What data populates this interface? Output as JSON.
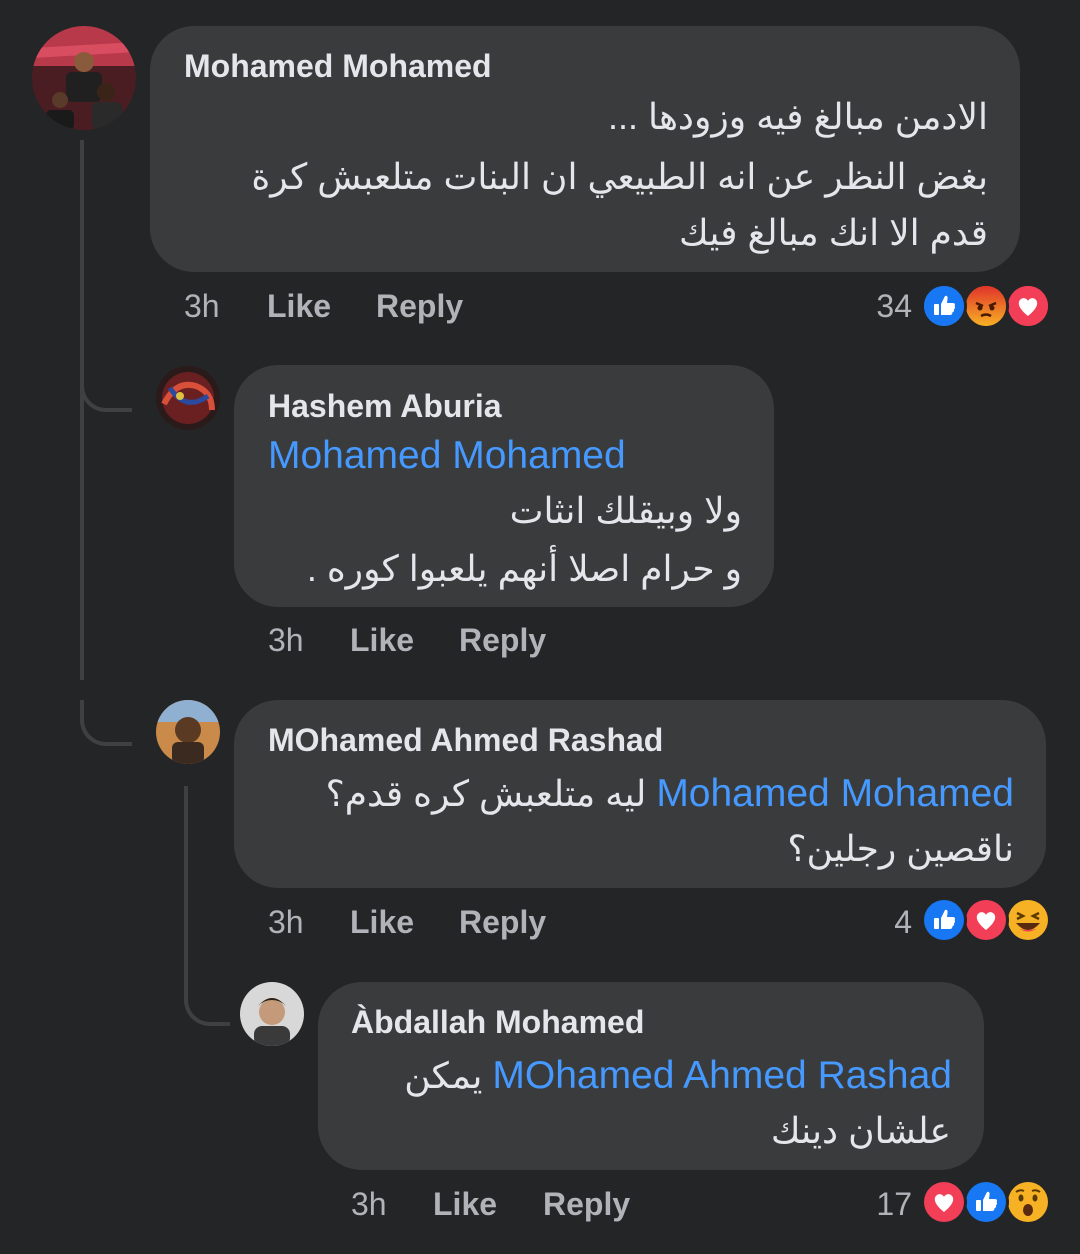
{
  "comments": [
    {
      "author": "Mohamed Mohamed",
      "lines": [
        "الادمن مبالغ فيه وزودها ...",
        "بغض النظر عن انه الطبيعي ان البنات متلعبش كرة",
        "قدم الا انك مبالغ فيك"
      ],
      "time": "3h",
      "like": "Like",
      "reply": "Reply",
      "reaction_count": "34",
      "reactions": [
        "like-icon",
        "angry-icon",
        "love-icon"
      ]
    },
    {
      "author": "Hashem Aburia",
      "mention": "Mohamed Mohamed",
      "lines": [
        "ولا وبيقلك انثات",
        "و حرام اصلا أنهم يلعبوا كوره ."
      ],
      "time": "3h",
      "like": "Like",
      "reply": "Reply"
    },
    {
      "author": "MOhamed Ahmed Rashad",
      "mention": "Mohamed Mohamed",
      "line1_text": "ليه متلعبش كره قدم؟",
      "line2": "ناقصين رجلين؟",
      "time": "3h",
      "like": "Like",
      "reply": "Reply",
      "reaction_count": "4",
      "reactions": [
        "like-icon",
        "love-icon",
        "haha-icon"
      ]
    },
    {
      "author": "Àbdallah Mohamed",
      "mention": "MOhamed Ahmed Rashad",
      "line1_text": "يمكن",
      "line2": "علشان دينك",
      "time": "3h",
      "like": "Like",
      "reply": "Reply",
      "reaction_count": "17",
      "reactions": [
        "love-icon",
        "like-icon",
        "wow-icon"
      ]
    }
  ],
  "colors": {
    "background": "#242527",
    "bubble": "#3a3b3c",
    "mention": "#4599ff",
    "meta": "#b0b3b8",
    "like": "#1877f2",
    "love": "#f33e58",
    "angry": "#e9710f",
    "haha": "#f7b125"
  }
}
